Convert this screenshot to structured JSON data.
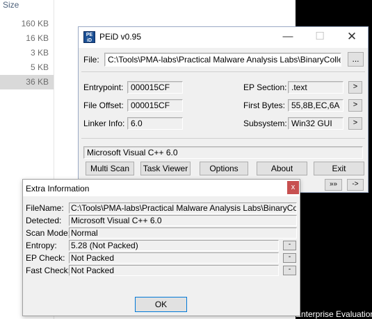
{
  "explorer": {
    "column_header": "Size",
    "sizes": [
      "160 KB",
      "16 KB",
      "3 KB",
      "5 KB",
      "36 KB"
    ],
    "selected_index": 4,
    "taskbar_text": "Enterprise Evaluation"
  },
  "peid": {
    "title": "PEiD v0.95",
    "logo_text": "PE iD",
    "file_label": "File:",
    "file_path": "C:\\Tools\\PMA-labs\\Practical Malware Analysis Labs\\BinaryCollection\\C",
    "browse_label": "...",
    "entrypoint_label": "Entrypoint:",
    "entrypoint": "000015CF",
    "file_offset_label": "File Offset:",
    "file_offset": "000015CF",
    "linker_info_label": "Linker Info:",
    "linker_info": "6.0",
    "ep_section_label": "EP Section:",
    "ep_section": ".text",
    "first_bytes_label": "First Bytes:",
    "first_bytes": "55,8B,EC,6A",
    "subsystem_label": "Subsystem:",
    "subsystem": "Win32 GUI",
    "arrow_label": ">",
    "detection": "Microsoft Visual C++ 6.0",
    "buttons": {
      "multi_scan": "Multi Scan",
      "task_viewer": "Task Viewer",
      "options": "Options",
      "about": "About",
      "exit": "Exit",
      "double_arrow": "»»",
      "arrow_next": "->"
    },
    "window_controls": {
      "minimize": "—",
      "maximize": "☐",
      "close": "✕"
    }
  },
  "extra": {
    "title": "Extra Information",
    "close": "x",
    "filename_label": "FileName:",
    "filename": "C:\\Tools\\PMA-labs\\Practical Malware Analysis Labs\\BinaryCollection\\",
    "detected_label": "Detected:",
    "detected": "Microsoft Visual C++ 6.0",
    "scan_mode_label": "Scan Mode:",
    "scan_mode": "Normal",
    "entropy_label": "Entropy:",
    "entropy": "5.28 (Not Packed)",
    "ep_check_label": "EP Check:",
    "ep_check": "Not Packed",
    "fast_check_label": "Fast Check:",
    "fast_check": "Not Packed",
    "mini_button": "-",
    "ok_label": "OK"
  }
}
